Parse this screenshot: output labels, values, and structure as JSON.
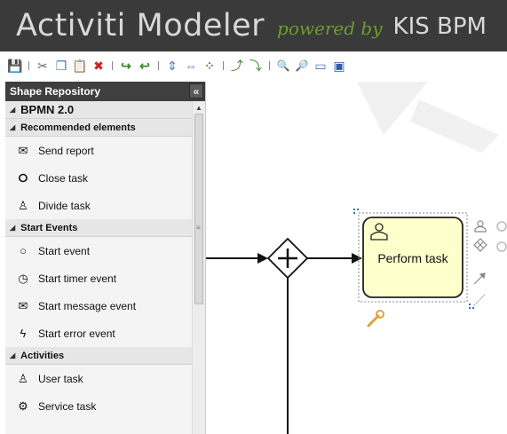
{
  "header": {
    "app_title": "Activiti Modeler",
    "powered_by": "powered by",
    "brand": "KIS BPM"
  },
  "toolbar": {
    "buttons": [
      {
        "icon": "save-icon",
        "glyph": "💾"
      },
      {
        "icon": "cut-icon",
        "glyph": "✂"
      },
      {
        "icon": "copy-icon",
        "glyph": "❐"
      },
      {
        "icon": "paste-icon",
        "glyph": "📋"
      },
      {
        "icon": "delete-icon",
        "glyph": "✖"
      },
      {
        "icon": "redo-icon",
        "glyph": "↪"
      },
      {
        "icon": "undo-icon",
        "glyph": "↩"
      },
      {
        "icon": "align-vertical-icon",
        "glyph": "⇕"
      },
      {
        "icon": "align-horizontal-icon",
        "glyph": "⇔"
      },
      {
        "icon": "same-size-icon",
        "glyph": "⁘"
      },
      {
        "icon": "dock-in-icon",
        "glyph": "⤴"
      },
      {
        "icon": "dock-out-icon",
        "glyph": "⤵"
      },
      {
        "icon": "zoom-in-icon",
        "glyph": "🔍"
      },
      {
        "icon": "zoom-out-icon",
        "glyph": "🔎"
      },
      {
        "icon": "zoom-actual-icon",
        "glyph": "▭"
      },
      {
        "icon": "zoom-fit-icon",
        "glyph": "▣"
      }
    ]
  },
  "sidebar": {
    "title": "Shape Repository",
    "collapse_glyph": "«",
    "root_group": "BPMN 2.0",
    "groups": [
      {
        "label": "Recommended elements",
        "items": [
          {
            "label": "Send report",
            "icon": "envelope-icon",
            "glyph": "✉"
          },
          {
            "label": "Close task",
            "icon": "end-event-icon",
            "glyph": "⭘"
          },
          {
            "label": "Divide task",
            "icon": "user-task-icon",
            "glyph": "♙"
          }
        ]
      },
      {
        "label": "Start Events",
        "items": [
          {
            "label": "Start event",
            "icon": "start-event-icon",
            "glyph": "○"
          },
          {
            "label": "Start timer event",
            "icon": "timer-event-icon",
            "glyph": "◷"
          },
          {
            "label": "Start message event",
            "icon": "message-event-icon",
            "glyph": "✉"
          },
          {
            "label": "Start error event",
            "icon": "error-event-icon",
            "glyph": "ϟ"
          }
        ]
      },
      {
        "label": "Activities",
        "items": [
          {
            "label": "User task",
            "icon": "user-task-icon",
            "glyph": "♙"
          },
          {
            "label": "Service task",
            "icon": "service-task-icon",
            "glyph": "⚙"
          }
        ]
      }
    ]
  },
  "canvas": {
    "task_label": "Perform task",
    "gateway_symbol": "+",
    "colors": {
      "task_fill": "#ffffcc",
      "task_stroke": "#222222",
      "selection": "#888888",
      "handle": "#3a6fb5",
      "wrench": "#e0a040"
    }
  },
  "colors": {
    "header_bg": "#3a3a3a",
    "header_text": "#d8d8d8",
    "powered_text": "#6d9e2c",
    "sidebar_header_bg": "#3f3f3f"
  }
}
